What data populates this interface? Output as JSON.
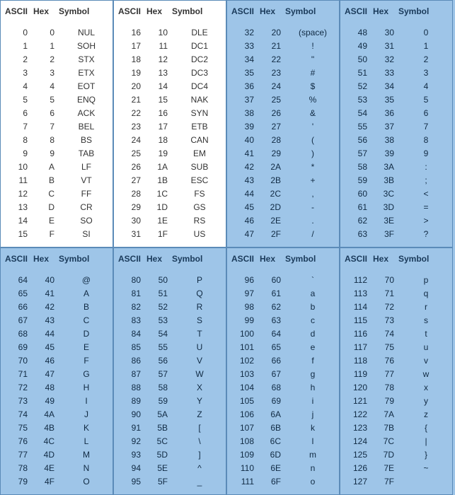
{
  "headers": {
    "ascii": "ASCII",
    "hex": "Hex",
    "symbol": "Symbol"
  },
  "panels": [
    {
      "white": true,
      "rows": [
        {
          "a": "0",
          "h": "0",
          "s": "NUL"
        },
        {
          "a": "1",
          "h": "1",
          "s": "SOH"
        },
        {
          "a": "2",
          "h": "2",
          "s": "STX"
        },
        {
          "a": "3",
          "h": "3",
          "s": "ETX"
        },
        {
          "a": "4",
          "h": "4",
          "s": "EOT"
        },
        {
          "a": "5",
          "h": "5",
          "s": "ENQ"
        },
        {
          "a": "6",
          "h": "6",
          "s": "ACK"
        },
        {
          "a": "7",
          "h": "7",
          "s": "BEL"
        },
        {
          "a": "8",
          "h": "8",
          "s": "BS"
        },
        {
          "a": "9",
          "h": "9",
          "s": "TAB"
        },
        {
          "a": "10",
          "h": "A",
          "s": "LF"
        },
        {
          "a": "11",
          "h": "B",
          "s": "VT"
        },
        {
          "a": "12",
          "h": "C",
          "s": "FF"
        },
        {
          "a": "13",
          "h": "D",
          "s": "CR"
        },
        {
          "a": "14",
          "h": "E",
          "s": "SO"
        },
        {
          "a": "15",
          "h": "F",
          "s": "SI"
        }
      ]
    },
    {
      "white": true,
      "rows": [
        {
          "a": "16",
          "h": "10",
          "s": "DLE"
        },
        {
          "a": "17",
          "h": "11",
          "s": "DC1"
        },
        {
          "a": "18",
          "h": "12",
          "s": "DC2"
        },
        {
          "a": "19",
          "h": "13",
          "s": "DC3"
        },
        {
          "a": "20",
          "h": "14",
          "s": "DC4"
        },
        {
          "a": "21",
          "h": "15",
          "s": "NAK"
        },
        {
          "a": "22",
          "h": "16",
          "s": "SYN"
        },
        {
          "a": "23",
          "h": "17",
          "s": "ETB"
        },
        {
          "a": "24",
          "h": "18",
          "s": "CAN"
        },
        {
          "a": "25",
          "h": "19",
          "s": "EM"
        },
        {
          "a": "26",
          "h": "1A",
          "s": "SUB"
        },
        {
          "a": "27",
          "h": "1B",
          "s": "ESC"
        },
        {
          "a": "28",
          "h": "1C",
          "s": "FS"
        },
        {
          "a": "29",
          "h": "1D",
          "s": "GS"
        },
        {
          "a": "30",
          "h": "1E",
          "s": "RS"
        },
        {
          "a": "31",
          "h": "1F",
          "s": "US"
        }
      ]
    },
    {
      "white": false,
      "rows": [
        {
          "a": "32",
          "h": "20",
          "s": "(space)"
        },
        {
          "a": "33",
          "h": "21",
          "s": "!"
        },
        {
          "a": "34",
          "h": "22",
          "s": "\""
        },
        {
          "a": "35",
          "h": "23",
          "s": "#"
        },
        {
          "a": "36",
          "h": "24",
          "s": "$"
        },
        {
          "a": "37",
          "h": "25",
          "s": "%"
        },
        {
          "a": "38",
          "h": "26",
          "s": "&"
        },
        {
          "a": "39",
          "h": "27",
          "s": "'"
        },
        {
          "a": "40",
          "h": "28",
          "s": "("
        },
        {
          "a": "41",
          "h": "29",
          "s": ")"
        },
        {
          "a": "42",
          "h": "2A",
          "s": "*"
        },
        {
          "a": "43",
          "h": "2B",
          "s": "+"
        },
        {
          "a": "44",
          "h": "2C",
          "s": ","
        },
        {
          "a": "45",
          "h": "2D",
          "s": "-"
        },
        {
          "a": "46",
          "h": "2E",
          "s": "."
        },
        {
          "a": "47",
          "h": "2F",
          "s": "/"
        }
      ]
    },
    {
      "white": false,
      "rows": [
        {
          "a": "48",
          "h": "30",
          "s": "0"
        },
        {
          "a": "49",
          "h": "31",
          "s": "1"
        },
        {
          "a": "50",
          "h": "32",
          "s": "2"
        },
        {
          "a": "51",
          "h": "33",
          "s": "3"
        },
        {
          "a": "52",
          "h": "34",
          "s": "4"
        },
        {
          "a": "53",
          "h": "35",
          "s": "5"
        },
        {
          "a": "54",
          "h": "36",
          "s": "6"
        },
        {
          "a": "55",
          "h": "37",
          "s": "7"
        },
        {
          "a": "56",
          "h": "38",
          "s": "8"
        },
        {
          "a": "57",
          "h": "39",
          "s": "9"
        },
        {
          "a": "58",
          "h": "3A",
          "s": ":"
        },
        {
          "a": "59",
          "h": "3B",
          "s": ";"
        },
        {
          "a": "60",
          "h": "3C",
          "s": "<"
        },
        {
          "a": "61",
          "h": "3D",
          "s": "="
        },
        {
          "a": "62",
          "h": "3E",
          "s": ">"
        },
        {
          "a": "63",
          "h": "3F",
          "s": "?"
        }
      ]
    },
    {
      "white": false,
      "rows": [
        {
          "a": "64",
          "h": "40",
          "s": "@"
        },
        {
          "a": "65",
          "h": "41",
          "s": "A"
        },
        {
          "a": "66",
          "h": "42",
          "s": "B"
        },
        {
          "a": "67",
          "h": "43",
          "s": "C"
        },
        {
          "a": "68",
          "h": "44",
          "s": "D"
        },
        {
          "a": "69",
          "h": "45",
          "s": "E"
        },
        {
          "a": "70",
          "h": "46",
          "s": "F"
        },
        {
          "a": "71",
          "h": "47",
          "s": "G"
        },
        {
          "a": "72",
          "h": "48",
          "s": "H"
        },
        {
          "a": "73",
          "h": "49",
          "s": "I"
        },
        {
          "a": "74",
          "h": "4A",
          "s": "J"
        },
        {
          "a": "75",
          "h": "4B",
          "s": "K"
        },
        {
          "a": "76",
          "h": "4C",
          "s": "L"
        },
        {
          "a": "77",
          "h": "4D",
          "s": "M"
        },
        {
          "a": "78",
          "h": "4E",
          "s": "N"
        },
        {
          "a": "79",
          "h": "4F",
          "s": "O"
        }
      ]
    },
    {
      "white": false,
      "rows": [
        {
          "a": "80",
          "h": "50",
          "s": "P"
        },
        {
          "a": "81",
          "h": "51",
          "s": "Q"
        },
        {
          "a": "82",
          "h": "52",
          "s": "R"
        },
        {
          "a": "83",
          "h": "53",
          "s": "S"
        },
        {
          "a": "84",
          "h": "54",
          "s": "T"
        },
        {
          "a": "85",
          "h": "55",
          "s": "U"
        },
        {
          "a": "86",
          "h": "56",
          "s": "V"
        },
        {
          "a": "87",
          "h": "57",
          "s": "W"
        },
        {
          "a": "88",
          "h": "58",
          "s": "X"
        },
        {
          "a": "89",
          "h": "59",
          "s": "Y"
        },
        {
          "a": "90",
          "h": "5A",
          "s": "Z"
        },
        {
          "a": "91",
          "h": "5B",
          "s": "["
        },
        {
          "a": "92",
          "h": "5C",
          "s": "\\"
        },
        {
          "a": "93",
          "h": "5D",
          "s": "]"
        },
        {
          "a": "94",
          "h": "5E",
          "s": "^"
        },
        {
          "a": "95",
          "h": "5F",
          "s": "_"
        }
      ]
    },
    {
      "white": false,
      "rows": [
        {
          "a": "96",
          "h": "60",
          "s": "`"
        },
        {
          "a": "97",
          "h": "61",
          "s": "a"
        },
        {
          "a": "98",
          "h": "62",
          "s": "b"
        },
        {
          "a": "99",
          "h": "63",
          "s": "c"
        },
        {
          "a": "100",
          "h": "64",
          "s": "d"
        },
        {
          "a": "101",
          "h": "65",
          "s": "e"
        },
        {
          "a": "102",
          "h": "66",
          "s": "f"
        },
        {
          "a": "103",
          "h": "67",
          "s": "g"
        },
        {
          "a": "104",
          "h": "68",
          "s": "h"
        },
        {
          "a": "105",
          "h": "69",
          "s": "i"
        },
        {
          "a": "106",
          "h": "6A",
          "s": "j"
        },
        {
          "a": "107",
          "h": "6B",
          "s": "k"
        },
        {
          "a": "108",
          "h": "6C",
          "s": "l"
        },
        {
          "a": "109",
          "h": "6D",
          "s": "m"
        },
        {
          "a": "110",
          "h": "6E",
          "s": "n"
        },
        {
          "a": "111",
          "h": "6F",
          "s": "o"
        }
      ]
    },
    {
      "white": false,
      "rows": [
        {
          "a": "112",
          "h": "70",
          "s": "p"
        },
        {
          "a": "113",
          "h": "71",
          "s": "q"
        },
        {
          "a": "114",
          "h": "72",
          "s": "r"
        },
        {
          "a": "115",
          "h": "73",
          "s": "s"
        },
        {
          "a": "116",
          "h": "74",
          "s": "t"
        },
        {
          "a": "117",
          "h": "75",
          "s": "u"
        },
        {
          "a": "118",
          "h": "76",
          "s": "v"
        },
        {
          "a": "119",
          "h": "77",
          "s": "w"
        },
        {
          "a": "120",
          "h": "78",
          "s": "x"
        },
        {
          "a": "121",
          "h": "79",
          "s": "y"
        },
        {
          "a": "122",
          "h": "7A",
          "s": "z"
        },
        {
          "a": "123",
          "h": "7B",
          "s": "{"
        },
        {
          "a": "124",
          "h": "7C",
          "s": "|"
        },
        {
          "a": "125",
          "h": "7D",
          "s": "}"
        },
        {
          "a": "126",
          "h": "7E",
          "s": "~"
        },
        {
          "a": "127",
          "h": "7F",
          "s": ""
        }
      ]
    }
  ]
}
